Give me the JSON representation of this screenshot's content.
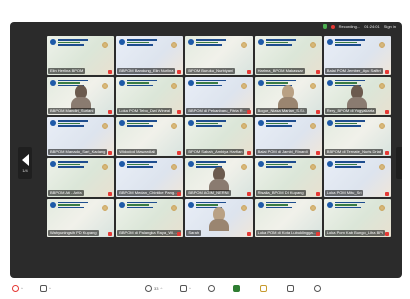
{
  "topbar": {
    "recording_label": "Recording...",
    "timer": "01:24:01",
    "sign_in_label": "Sign in"
  },
  "nav": {
    "page_indicator": "1/4"
  },
  "tiles": [
    {
      "name": "Elin Herlina BPOM",
      "type": "banner"
    },
    {
      "name": "BBPOM Bandung_Elin Nurlina",
      "type": "banner"
    },
    {
      "name": "BPOM Buruku_Nurbiyani",
      "type": "banner"
    },
    {
      "name": "Harima_BPOM Makassar",
      "type": "banner"
    },
    {
      "name": "Balai POM Jember_Ayu Safitri",
      "type": "banner"
    },
    {
      "name": "BBPOM Mandiri_Suriani",
      "type": "person"
    },
    {
      "name": "Loka POM Tebo_Dwi Wineal",
      "type": "banner"
    },
    {
      "name": "BBPOM di Pekanbaru_Fitria Ram...",
      "type": "banner"
    },
    {
      "name": "Bogor_Niasa Marian_S.Si.",
      "type": "person"
    },
    {
      "name": "Rery_BPOM di Yogyakarta",
      "type": "person"
    },
    {
      "name": "BBPOM Manado_Sari_Kadang",
      "type": "banner"
    },
    {
      "name": "Widodod Mawardiali",
      "type": "banner"
    },
    {
      "name": "BPOM Sabah_Ambiya Harfian",
      "type": "banner"
    },
    {
      "name": "Balai POM di Jambi_Rinardi",
      "type": "banner"
    },
    {
      "name": "BBPOM di Ternate_Nuris Driat",
      "type": "banner"
    },
    {
      "name": "BBPOM Ati - Arifa",
      "type": "banner"
    },
    {
      "name": "BBPOM Medan_Chintike Panggal...",
      "type": "banner"
    },
    {
      "name": "BBPOM AGIM_NERNI",
      "type": "person"
    },
    {
      "name": "Risalia_BPOM DI Kupang",
      "type": "banner"
    },
    {
      "name": "Loka POM Mitu_Sri",
      "type": "banner"
    },
    {
      "name": "Wahyuningsih PD Kupang",
      "type": "banner"
    },
    {
      "name": "BBPOM di Palangka Raya_Wida...",
      "type": "banner"
    },
    {
      "name": "Sarah",
      "type": "person"
    },
    {
      "name": "Loka POM di Kota Lubuklinggau...",
      "type": "banner"
    },
    {
      "name": "Loka Pom Kab Bungo_Liha BPI",
      "type": "banner"
    }
  ],
  "toolbar": {
    "participants_count": "33",
    "chat_label": "",
    "more_label": ""
  }
}
